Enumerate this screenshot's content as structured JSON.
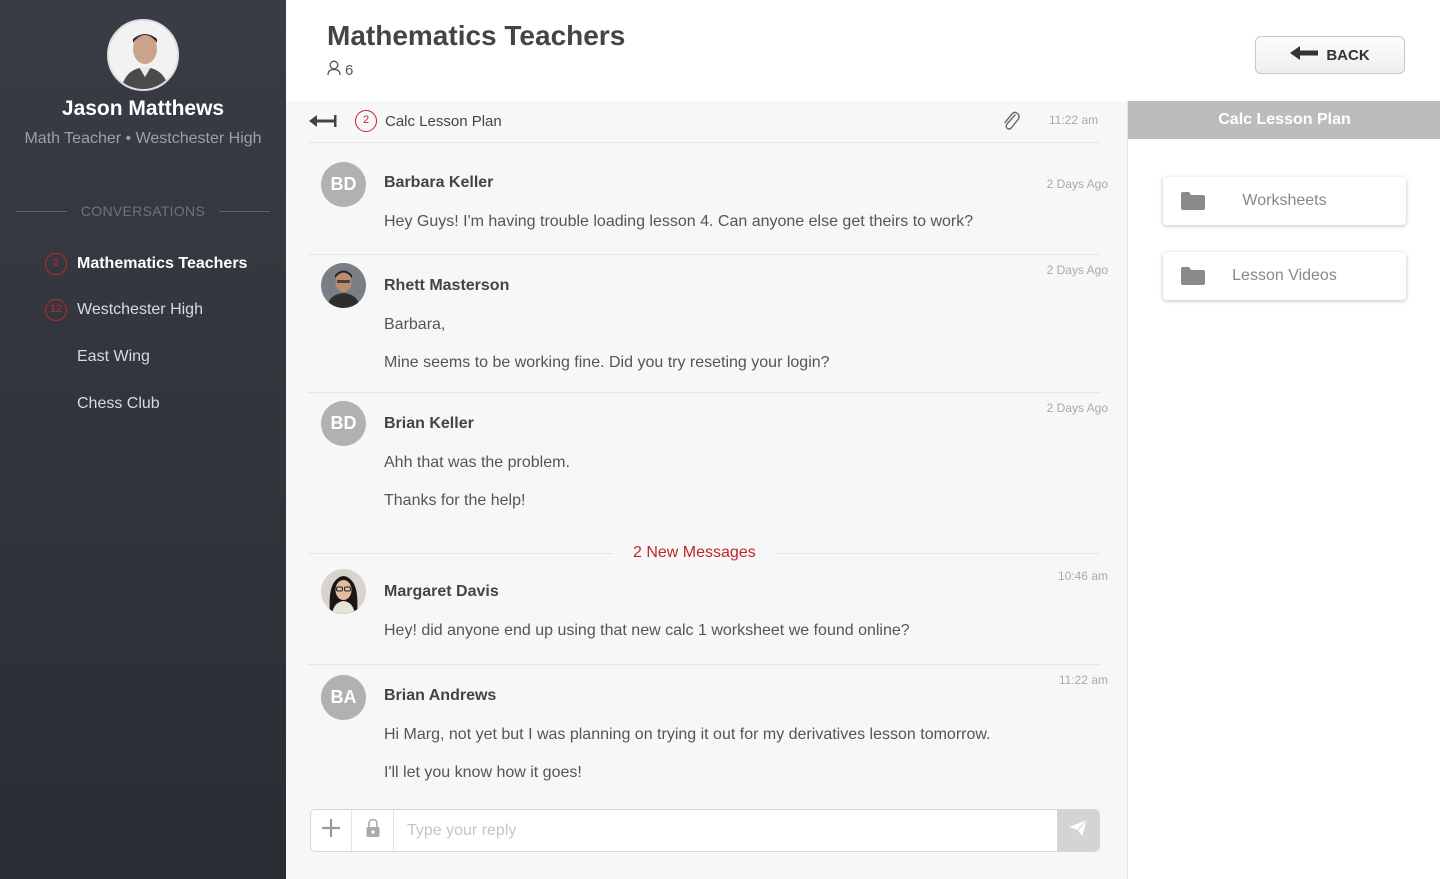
{
  "user": {
    "name": "Jason Matthews",
    "role": "Math Teacher • Westchester High"
  },
  "sidebar": {
    "section_label": "CONVERSATIONS",
    "items": [
      {
        "label": "Mathematics Teachers",
        "badge": "2",
        "active": true
      },
      {
        "label": "Westchester High",
        "badge": "12",
        "active": false
      },
      {
        "label": "East Wing",
        "badge": "",
        "active": false
      },
      {
        "label": "Chess Club",
        "badge": "",
        "active": false
      }
    ]
  },
  "header": {
    "title": "Mathematics Teachers",
    "member_count": "6",
    "back_label": "BACK"
  },
  "thread": {
    "badge": "2",
    "title": "Calc Lesson Plan",
    "time": "11:22 am"
  },
  "messages": [
    {
      "initials": "BD",
      "name": "Barbara Keller",
      "time": "2 Days Ago",
      "lines": [
        "Hey Guys! I'm having trouble loading lesson 4. Can anyone else get theirs to work?"
      ]
    },
    {
      "initials": "",
      "name": "Rhett Masterson",
      "time": "2 Days Ago",
      "lines": [
        "Barbara,",
        "Mine seems to be working fine. Did you try reseting your login?"
      ]
    },
    {
      "initials": "BD",
      "name": "Brian Keller",
      "time": "2 Days Ago",
      "lines": [
        "Ahh that was the problem.",
        "Thanks for the help!"
      ]
    },
    {
      "initials": "",
      "name": "Margaret Davis",
      "time": "10:46 am",
      "lines": [
        "Hey! did anyone end up using that new calc 1 worksheet we found online?"
      ]
    },
    {
      "initials": "BA",
      "name": "Brian Andrews",
      "time": "11:22 am",
      "lines": [
        "Hi Marg, not yet but I was planning on trying it out for my derivatives lesson tomorrow.",
        "I'll let you know how it goes!"
      ]
    }
  ],
  "new_messages_label": "2 New Messages",
  "reply": {
    "placeholder": "Type your reply"
  },
  "panel": {
    "title": "Calc Lesson Plan",
    "folders": [
      {
        "label": "Worksheets"
      },
      {
        "label": "Lesson Videos"
      }
    ]
  },
  "colors": {
    "accent_red": "#c0272d",
    "sidebar_bg": "#2f3239",
    "panel_header": "#bcbcbc"
  }
}
